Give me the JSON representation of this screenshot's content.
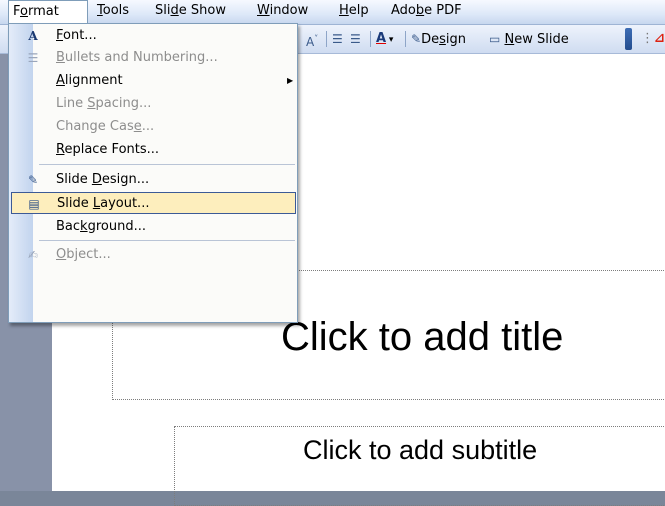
{
  "menubar": {
    "items": [
      {
        "label": "Format",
        "pre": "F",
        "ul": "o",
        "post": "rmat",
        "active": true
      },
      {
        "label": "Tools",
        "pre": "",
        "ul": "T",
        "post": "ools"
      },
      {
        "label": "Slide Show",
        "pre": "Sli",
        "ul": "d",
        "post": "e Show"
      },
      {
        "label": "Window",
        "pre": "",
        "ul": "W",
        "post": "indow"
      },
      {
        "label": "Help",
        "pre": "",
        "ul": "H",
        "post": "elp"
      },
      {
        "label": "Adobe PDF",
        "pre": "Ado",
        "ul": "b",
        "post": "e PDF"
      }
    ]
  },
  "toolbar": {
    "design_pre": "De",
    "design_ul": "s",
    "design_post": "ign",
    "newslide_ul": "N",
    "newslide_post": "ew Slide"
  },
  "format_menu": {
    "font": {
      "ul": "F",
      "post": "ont..."
    },
    "bullets": {
      "ul": "B",
      "post": "ullets and Numbering..."
    },
    "alignment": {
      "ul": "A",
      "post": "lignment"
    },
    "line_spacing": {
      "pre": "Line ",
      "ul": "S",
      "post": "pacing..."
    },
    "change_case": {
      "pre": "Change Cas",
      "ul": "e",
      "post": "..."
    },
    "replace_fonts": {
      "ul": "R",
      "post": "eplace Fonts..."
    },
    "slide_design": {
      "pre": "Slide ",
      "ul": "D",
      "post": "esign..."
    },
    "slide_layout": {
      "pre": "Slide ",
      "ul": "L",
      "post": "ayout..."
    },
    "background": {
      "pre": "Bac",
      "ul": "k",
      "post": "ground..."
    },
    "object": {
      "ul": "O",
      "post": "bject..."
    }
  },
  "slide": {
    "title_placeholder": "Click to add title",
    "subtitle_placeholder": "Click to add subtitle"
  },
  "colors": {
    "highlight": "#fdeebd",
    "menu_border": "#7f9db9",
    "disabled_text": "#8d8d8d"
  }
}
